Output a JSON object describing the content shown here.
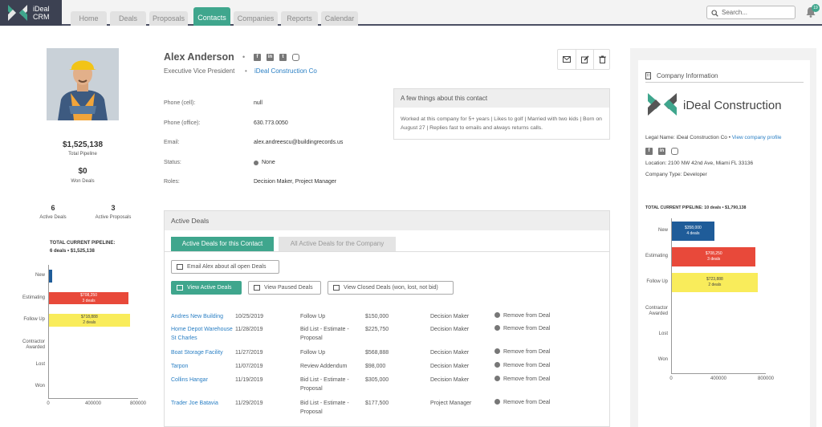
{
  "app": {
    "name_line1": "iDeal",
    "name_line2": "CRM"
  },
  "nav": {
    "tabs": [
      "Home",
      "Deals",
      "Proposals",
      "Contacts",
      "Companies",
      "Reports",
      "Calendar"
    ],
    "active": "Contacts"
  },
  "search": {
    "placeholder": "Search..."
  },
  "notifications": {
    "count": "19"
  },
  "contact": {
    "name": "Alex Anderson",
    "title": "Executive Vice President",
    "separator": "•",
    "company": "iDeal Construction Co",
    "total_pipeline_value": "$1,525,138",
    "total_pipeline_label": "Total Pipeline",
    "won_value": "$0",
    "won_label": "Won Deals",
    "active_deals_count": "6",
    "active_deals_label": "Active Deals",
    "active_proposals_count": "3",
    "active_proposals_label": "Active Proposals",
    "social": [
      "facebook-icon",
      "linkedin-icon",
      "twitter-icon",
      "instagram-icon"
    ],
    "fields": [
      {
        "label": "Phone (cell):",
        "value": "null"
      },
      {
        "label": "Phone (office):",
        "value": "630.773.0050"
      },
      {
        "label": "Email:",
        "value": "alex.andreescu@buildingrecords.us"
      },
      {
        "label": "Status:",
        "value": "None"
      },
      {
        "label": "Roles:",
        "value": "Decision Maker, Project Manager"
      }
    ]
  },
  "about": {
    "title": "A few things about this contact",
    "text": "Worked at this company for 5+ years | Likes to golf | Married with two kids | Born on August 27 | Replies fast to emails and always returns calls."
  },
  "contact_chart": {
    "title": "TOTAL CURRENT PIPELINE:",
    "subtitle": "6 deals • $1,525,138"
  },
  "active_deals": {
    "title": "Active Deals",
    "tab_contact": "Active Deals for this Contact",
    "tab_company": "All Active Deals for the Company",
    "email_button": "Email Alex about all open Deals",
    "view_active": "View Active Deals",
    "view_paused": "View Paused Deals",
    "view_closed": "View Closed Deals (won, lost, not bid)",
    "remove_label": "Remove from Deal",
    "rows": [
      {
        "deal": "Andres New Building",
        "date": "10/25/2019",
        "stage": "Follow Up",
        "amount": "$150,000",
        "role": "Decision Maker"
      },
      {
        "deal": "Home Depot Warehouse St Charles",
        "date": "11/28/2019",
        "stage": "Bid List - Estimate - Proposal",
        "amount": "$225,750",
        "role": "Decision Maker"
      },
      {
        "deal": "Boat Storage Facility",
        "date": "11/27/2019",
        "stage": "Follow Up",
        "amount": "$568,888",
        "role": "Decision Maker"
      },
      {
        "deal": "Tarpon",
        "date": "11/07/2019",
        "stage": "Review Addendum",
        "amount": "$98,000",
        "role": "Decision Maker"
      },
      {
        "deal": "Collins Hangar",
        "date": "11/19/2019",
        "stage": "Bid List - Estimate - Proposal",
        "amount": "$305,000",
        "role": "Decision Maker"
      },
      {
        "deal": "Trader Joe Batavia",
        "date": "11/29/2019",
        "stage": "Bid List - Estimate - Proposal",
        "amount": "$177,500",
        "role": "Project Manager"
      }
    ]
  },
  "company": {
    "panel_title": "Company Information",
    "logo_text": "iDeal Construction",
    "legal_label": "Legal Name: iDeal Construction Co •",
    "view_profile": "View company profile",
    "location": "Location: 2100 NW 42nd Ave, Miami FL 33136",
    "type": "Company Type: Developer",
    "pipeline_title": "TOTAL CURRENT PIPELINE: 10 deals • $1,790,138"
  },
  "colors": {
    "accent": "#3fa68d",
    "new": "#1f5c99",
    "estimating": "#e8493a",
    "followup": "#f9ec5b",
    "header": "#3c4152"
  },
  "chart_data": [
    {
      "type": "bar",
      "orientation": "horizontal",
      "categories": [
        "New",
        "Estimating",
        "Follow Up",
        "Contractor Awarded",
        "Lost",
        "Won"
      ],
      "values": [
        25000,
        708250,
        718888,
        0,
        0,
        0
      ],
      "labels": [
        "",
        "$708,250",
        "$718,888",
        "",
        "",
        ""
      ],
      "sublabels": [
        "",
        "3 deals",
        "2 deals",
        "",
        "",
        ""
      ],
      "xticks": [
        "0",
        "400000",
        "800000"
      ],
      "xlim": [
        0,
        800000
      ]
    },
    {
      "type": "bar",
      "orientation": "horizontal",
      "categories": [
        "New",
        "Estimating",
        "Follow Up",
        "Contractor Awarded",
        "Lost",
        "Won"
      ],
      "values": [
        358000,
        708250,
        723888,
        0,
        0,
        0
      ],
      "labels": [
        "$358,000",
        "$708,250",
        "$723,888",
        "",
        "",
        ""
      ],
      "sublabels": [
        "4 deals",
        "3 deals",
        "2 deals",
        "",
        "",
        ""
      ],
      "xticks": [
        "0",
        "400000",
        "800000"
      ],
      "xlim": [
        0,
        800000
      ]
    }
  ]
}
